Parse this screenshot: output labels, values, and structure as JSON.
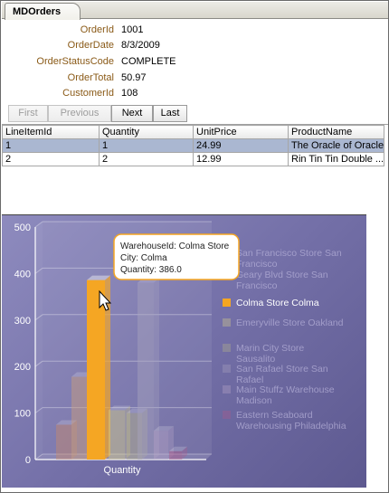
{
  "tab": {
    "title": "MDOrders"
  },
  "order": {
    "fields": [
      {
        "label": "OrderId",
        "value": "1001"
      },
      {
        "label": "OrderDate",
        "value": "8/3/2009"
      },
      {
        "label": "OrderStatusCode",
        "value": "COMPLETE"
      },
      {
        "label": "OrderTotal",
        "value": "50.97"
      },
      {
        "label": "CustomerId",
        "value": "108"
      }
    ]
  },
  "navigator": {
    "first": "First",
    "previous": "Previous",
    "next": "Next",
    "last": "Last"
  },
  "lineitems": {
    "columns": [
      "LineItemId",
      "Quantity",
      "UnitPrice",
      "ProductName"
    ],
    "rows": [
      [
        "1",
        "1",
        "24.99",
        "The Oracle of Oracle"
      ],
      [
        "2",
        "2",
        "12.99",
        "Rin Tin Tin Double ..."
      ]
    ]
  },
  "tooltip": {
    "line1": "WarehouseId: Colma Store",
    "line2": "City: Colma",
    "line3": "Quantity: 386.0"
  },
  "colors": {
    "highlight": "#f5a623",
    "chart_bg": "#7470a8",
    "label": "#8a5a17",
    "selected_row": "#aab7d1"
  },
  "chart_data": {
    "type": "bar",
    "categories": [
      "Quantity"
    ],
    "ylim": [
      0,
      500
    ],
    "yticks": [
      "0",
      "100",
      "200",
      "300",
      "400",
      "500"
    ],
    "xlabel": "Quantity",
    "legend_position": "right",
    "series": [
      {
        "name": "San Francisco Store San Francisco",
        "value": 75,
        "color": "#c98a6a",
        "highlighted": false
      },
      {
        "name": "Geary Blvd Store San Francisco",
        "value": 178,
        "color": "#cfa07a",
        "highlighted": false
      },
      {
        "name": "Colma Store Colma",
        "value": 386,
        "color": "#f5a623",
        "highlighted": true
      },
      {
        "name": "Emeryville Store Oakland",
        "value": 106,
        "color": "#d9d28a",
        "highlighted": false
      },
      {
        "name": "Marin City Store Sausalito",
        "value": 100,
        "color": "#b7b48a",
        "highlighted": false
      },
      {
        "name": "San Rafael Store San Rafael",
        "value": 380,
        "color": "#a8a4bf",
        "highlighted": false
      },
      {
        "name": "Main Stuffz Warehouse Madison",
        "value": 62,
        "color": "#b9a7c9",
        "highlighted": false
      },
      {
        "name": "Eastern Seaboard Warehousing Philadelphia",
        "value": 18,
        "color": "#b05a8a",
        "highlighted": false
      }
    ]
  }
}
